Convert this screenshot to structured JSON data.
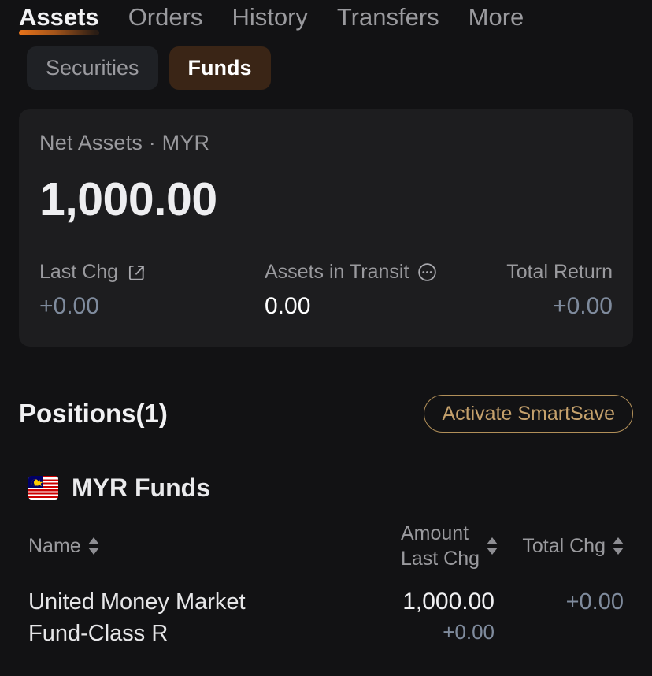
{
  "nav": {
    "tabs": [
      {
        "label": "Assets",
        "active": true
      },
      {
        "label": "Orders",
        "active": false
      },
      {
        "label": "History",
        "active": false
      },
      {
        "label": "Transfers",
        "active": false
      },
      {
        "label": "More",
        "active": false
      }
    ]
  },
  "segments": {
    "securities_label": "Securities",
    "funds_label": "Funds"
  },
  "net_assets_card": {
    "label": "Net Assets · MYR",
    "value": "1,000.00",
    "stats": [
      {
        "label": "Last Chg",
        "icon": "share-icon",
        "value": "+0.00",
        "tone": "muted"
      },
      {
        "label": "Assets in Transit",
        "icon": "more-info-icon",
        "value": "0.00",
        "tone": "white"
      },
      {
        "label": "Total Return",
        "icon": "",
        "value": "+0.00",
        "tone": "muted"
      }
    ]
  },
  "positions": {
    "title": "Positions(1)",
    "smartsave_label": "Activate SmartSave"
  },
  "fund_group": {
    "flag": "malaysia-flag",
    "title": "MYR Funds",
    "columns": {
      "name": "Name",
      "amount": "Amount",
      "amount_sub": "Last Chg",
      "total": "Total Chg"
    },
    "rows": [
      {
        "name_line1": "United Money Market",
        "name_line2": "Fund-Class R",
        "amount": "1,000.00",
        "last_chg": "+0.00",
        "total_chg": "+0.00"
      }
    ]
  },
  "colors": {
    "page_bg": "#121214",
    "card_bg": "#1d1d1f",
    "accent_orange": "#e8731a",
    "accent_gold": "#c5a16c",
    "muted_blue": "#7f8b9d",
    "funds_pill_bg": "#3a2516"
  }
}
